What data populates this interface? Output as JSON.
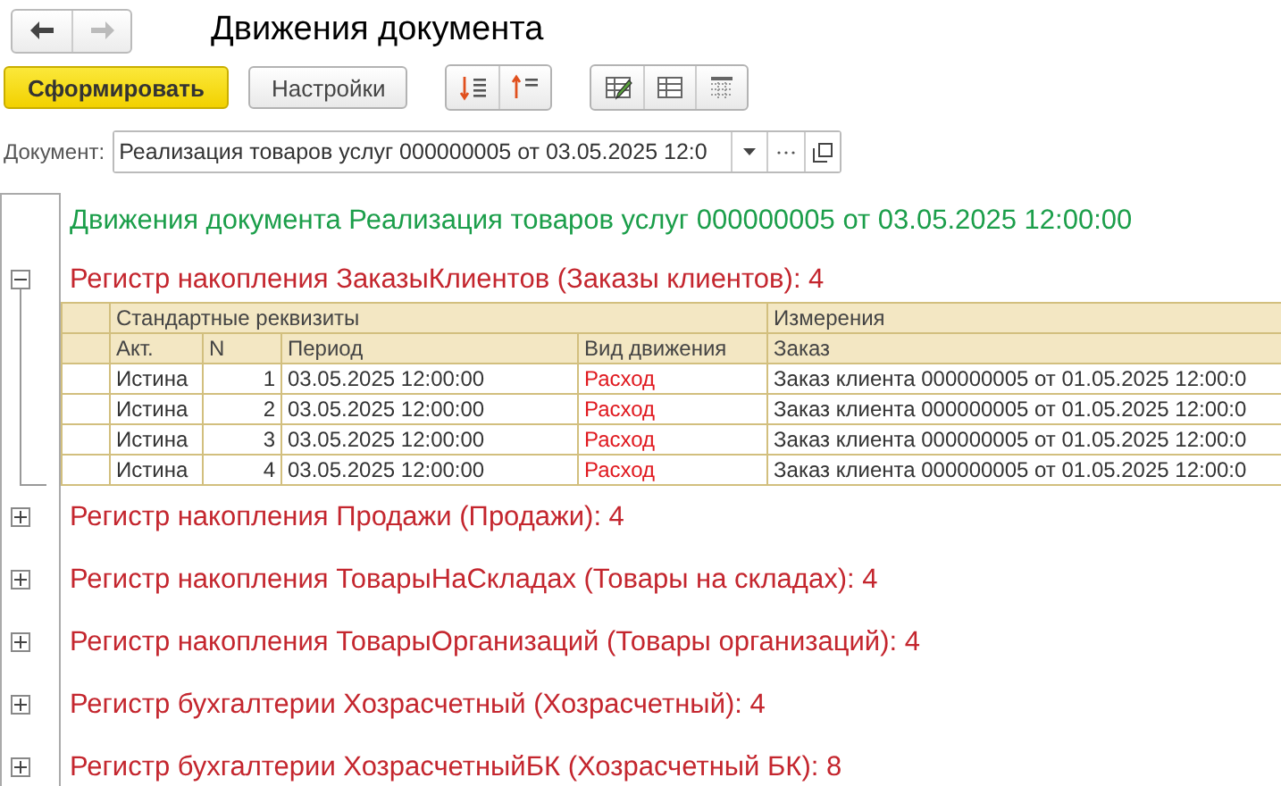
{
  "window": {
    "title": "Движения документа"
  },
  "nav": [
    {
      "kind": "back",
      "disabled": false
    },
    {
      "kind": "forward",
      "disabled": true
    }
  ],
  "toolbar": {
    "buttons": [
      {
        "label": "Сформировать",
        "kind": "primary"
      },
      {
        "label": "Настройки",
        "kind": "normal"
      }
    ]
  },
  "document_field": {
    "label": "Документ:",
    "value": "Реализация товаров услуг 000000005 от 03.05.2025 12:0"
  },
  "report": {
    "title": "Движения документа Реализация товаров услуг 000000005 от 03.05.2025 12:00:00",
    "registers": [
      {
        "title": "Регистр накопления ЗаказыКлиентов (Заказы клиентов): 4",
        "expanded": true,
        "table": {
          "groups": [
            {
              "label": "Стандартные реквизиты",
              "columns": [
                "Акт.",
                "N",
                "Период",
                "Вид движения"
              ]
            },
            {
              "label": "Измерения",
              "columns": [
                "Заказ"
              ]
            }
          ],
          "rows": [
            {
              "cells": [
                "Истина",
                "1",
                "03.05.2025 12:00:00",
                "Расход",
                "Заказ клиента 000000005 от 01.05.2025 12:00:0"
              ]
            },
            {
              "cells": [
                "Истина",
                "2",
                "03.05.2025 12:00:00",
                "Расход",
                "Заказ клиента 000000005 от 01.05.2025 12:00:0"
              ]
            },
            {
              "cells": [
                "Истина",
                "3",
                "03.05.2025 12:00:00",
                "Расход",
                "Заказ клиента 000000005 от 01.05.2025 12:00:0"
              ]
            },
            {
              "cells": [
                "Истина",
                "4",
                "03.05.2025 12:00:00",
                "Расход",
                "Заказ клиента 000000005 от 01.05.2025 12:00:0"
              ]
            }
          ]
        }
      },
      {
        "title": "Регистр накопления Продажи (Продажи): 4",
        "expanded": false
      },
      {
        "title": "Регистр накопления ТоварыНаСкладах (Товары на складах): 4",
        "expanded": false
      },
      {
        "title": "Регистр накопления ТоварыОрганизаций (Товары организаций): 4",
        "expanded": false
      },
      {
        "title": "Регистр бухгалтерии Хозрасчетный (Хозрасчетный): 4",
        "expanded": false
      },
      {
        "title": "Регистр бухгалтерии ХозрасчетныйБК (Хозрасчетный БК): 8",
        "expanded": false
      }
    ]
  }
}
